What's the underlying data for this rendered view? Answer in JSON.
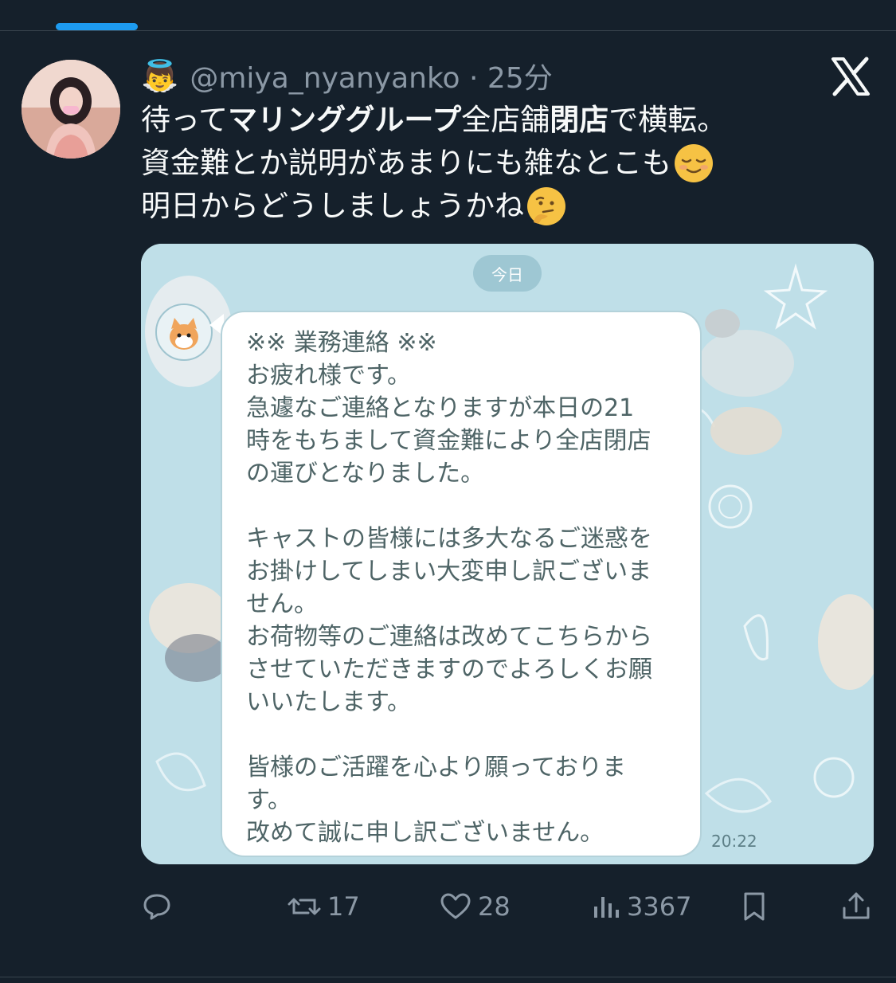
{
  "header": {
    "badge_emoji": "👼",
    "handle": "@miya_nyanyanko",
    "separator": "·",
    "time_ago": "25分"
  },
  "tweet": {
    "line1": {
      "a": "待って",
      "b": "マリンググループ",
      "c": "全店舗",
      "d": "閉店",
      "e": "で横転。"
    },
    "line2": "資金難とか説明があまりにも雑なとこも",
    "line2_emoji": "relieved-face-icon",
    "line3": "明日からどうしましょうかね",
    "line3_emoji": "thinking-face-icon"
  },
  "media": {
    "date_pill": "今日",
    "message_lines": [
      "※※ 業務連絡 ※※",
      "お疲れ様です。",
      "急遽なご連絡となりますが本日の21",
      "時をもちまして資金難により全店閉店",
      "の運びとなりました。",
      "",
      "キャストの皆様には多大なるご迷惑を",
      "お掛けしてしまい大変申し訳ございま",
      "せん。",
      "お荷物等のご連絡は改めてこちらから",
      "させていただきますのでよろしくお願",
      "いいたします。",
      "",
      "皆様のご活躍を心より願っておりま",
      "す。",
      "改めて誠に申し訳ございません。"
    ],
    "time": "20:22"
  },
  "actions": {
    "reply_count": "",
    "retweet_count": "17",
    "like_count": "28",
    "view_count": "3367"
  },
  "colors": {
    "background": "#15202b",
    "accent": "#1d9bf0",
    "muted": "#8b98a5",
    "text": "#f7f9f9",
    "chat_bg": "#bfdfe8"
  }
}
